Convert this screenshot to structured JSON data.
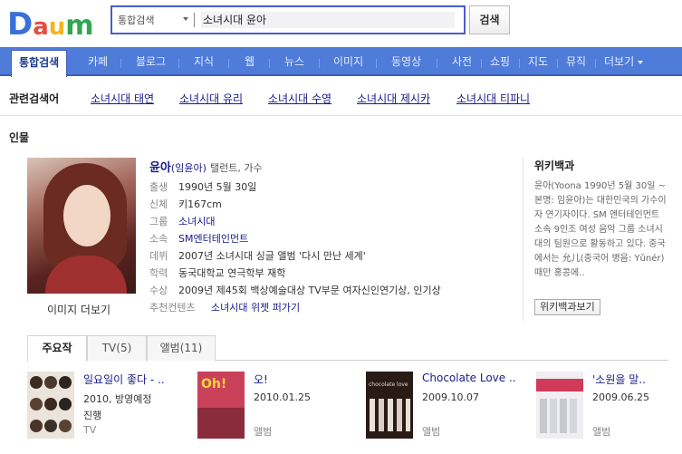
{
  "header": {
    "logo_text": "Daum",
    "search_scope": "통합검색",
    "query": "소녀시대 윤아",
    "search_button": "검색"
  },
  "tabs": [
    {
      "label": "통합검색",
      "active": true
    },
    {
      "label": "카페"
    },
    {
      "label": "블로그"
    },
    {
      "label": "지식"
    },
    {
      "label": "웹"
    },
    {
      "label": "뉴스"
    },
    {
      "label": "이미지"
    },
    {
      "label": "동영상"
    },
    {
      "label": "사전"
    },
    {
      "label": "쇼핑"
    },
    {
      "label": "지도"
    },
    {
      "label": "뮤직"
    },
    {
      "label": "더보기"
    }
  ],
  "related": {
    "label": "관련검색어",
    "items": [
      "소녀시대 태연",
      "소녀시대 유리",
      "소녀시대 수영",
      "소녀시대 제시카",
      "소녀시대 티파니"
    ]
  },
  "person": {
    "section_title": "인물",
    "photo_caption": "이미지 더보기",
    "name": "윤아",
    "real_name": "(임윤아)",
    "job": "탤런트, 가수",
    "info": [
      {
        "key": "출생",
        "value": "1990년 5월 30일"
      },
      {
        "key": "신체",
        "value": "키167cm"
      },
      {
        "key": "그룹",
        "value": "소녀시대"
      },
      {
        "key": "소속",
        "value": "SM엔터테인먼트"
      },
      {
        "key": "데뷔",
        "value": "2007년 소녀시대 싱글 앨범 '다시 만난 세계'"
      },
      {
        "key": "학력",
        "value": "동국대학교 연극학부 재학"
      },
      {
        "key": "수상",
        "value": "2009년 제45회 백상예술대상 TV부문 여자신인연기상, 인기상"
      }
    ],
    "recommend_label": "추천컨텐츠",
    "recommend_value": "소녀시대 위젯 퍼가기"
  },
  "wiki": {
    "title": "위키백과",
    "text": "윤아(Yoona 1990년 5월 30일 ~ 본명: 임윤아)는 대한민국의 가수이자 연기자이다. SM 엔터테인먼트 소속 9인조 여성 음악 그룹 소녀시대의 팀원으로 활동하고 있다. 중국에서는 允儿(중국어 병음: Yǔnér) 때만 홍콩에..",
    "button": "위키백과보기"
  },
  "works_tabs": [
    {
      "label": "주요작",
      "active": true
    },
    {
      "label": "TV(5)"
    },
    {
      "label": "앨범(11)"
    }
  ],
  "works": [
    {
      "title": "일요일이 좋다 - ..",
      "date": "2010, 방영예정",
      "extra": "진행",
      "sub": "TV"
    },
    {
      "title": "오!",
      "date": "2010.01.25",
      "extra": "",
      "sub": "앨범"
    },
    {
      "title": "Chocolate Love ..",
      "date": "2009.10.07",
      "extra": "",
      "sub": "앨범"
    },
    {
      "title": "'소원을 말..",
      "date": "2009.06.25",
      "extra": "",
      "sub": "앨범"
    }
  ],
  "colors": {
    "tab_bar": "#4f7bd9",
    "link": "#1a1a8a",
    "search_border": "#4a5cc8"
  }
}
